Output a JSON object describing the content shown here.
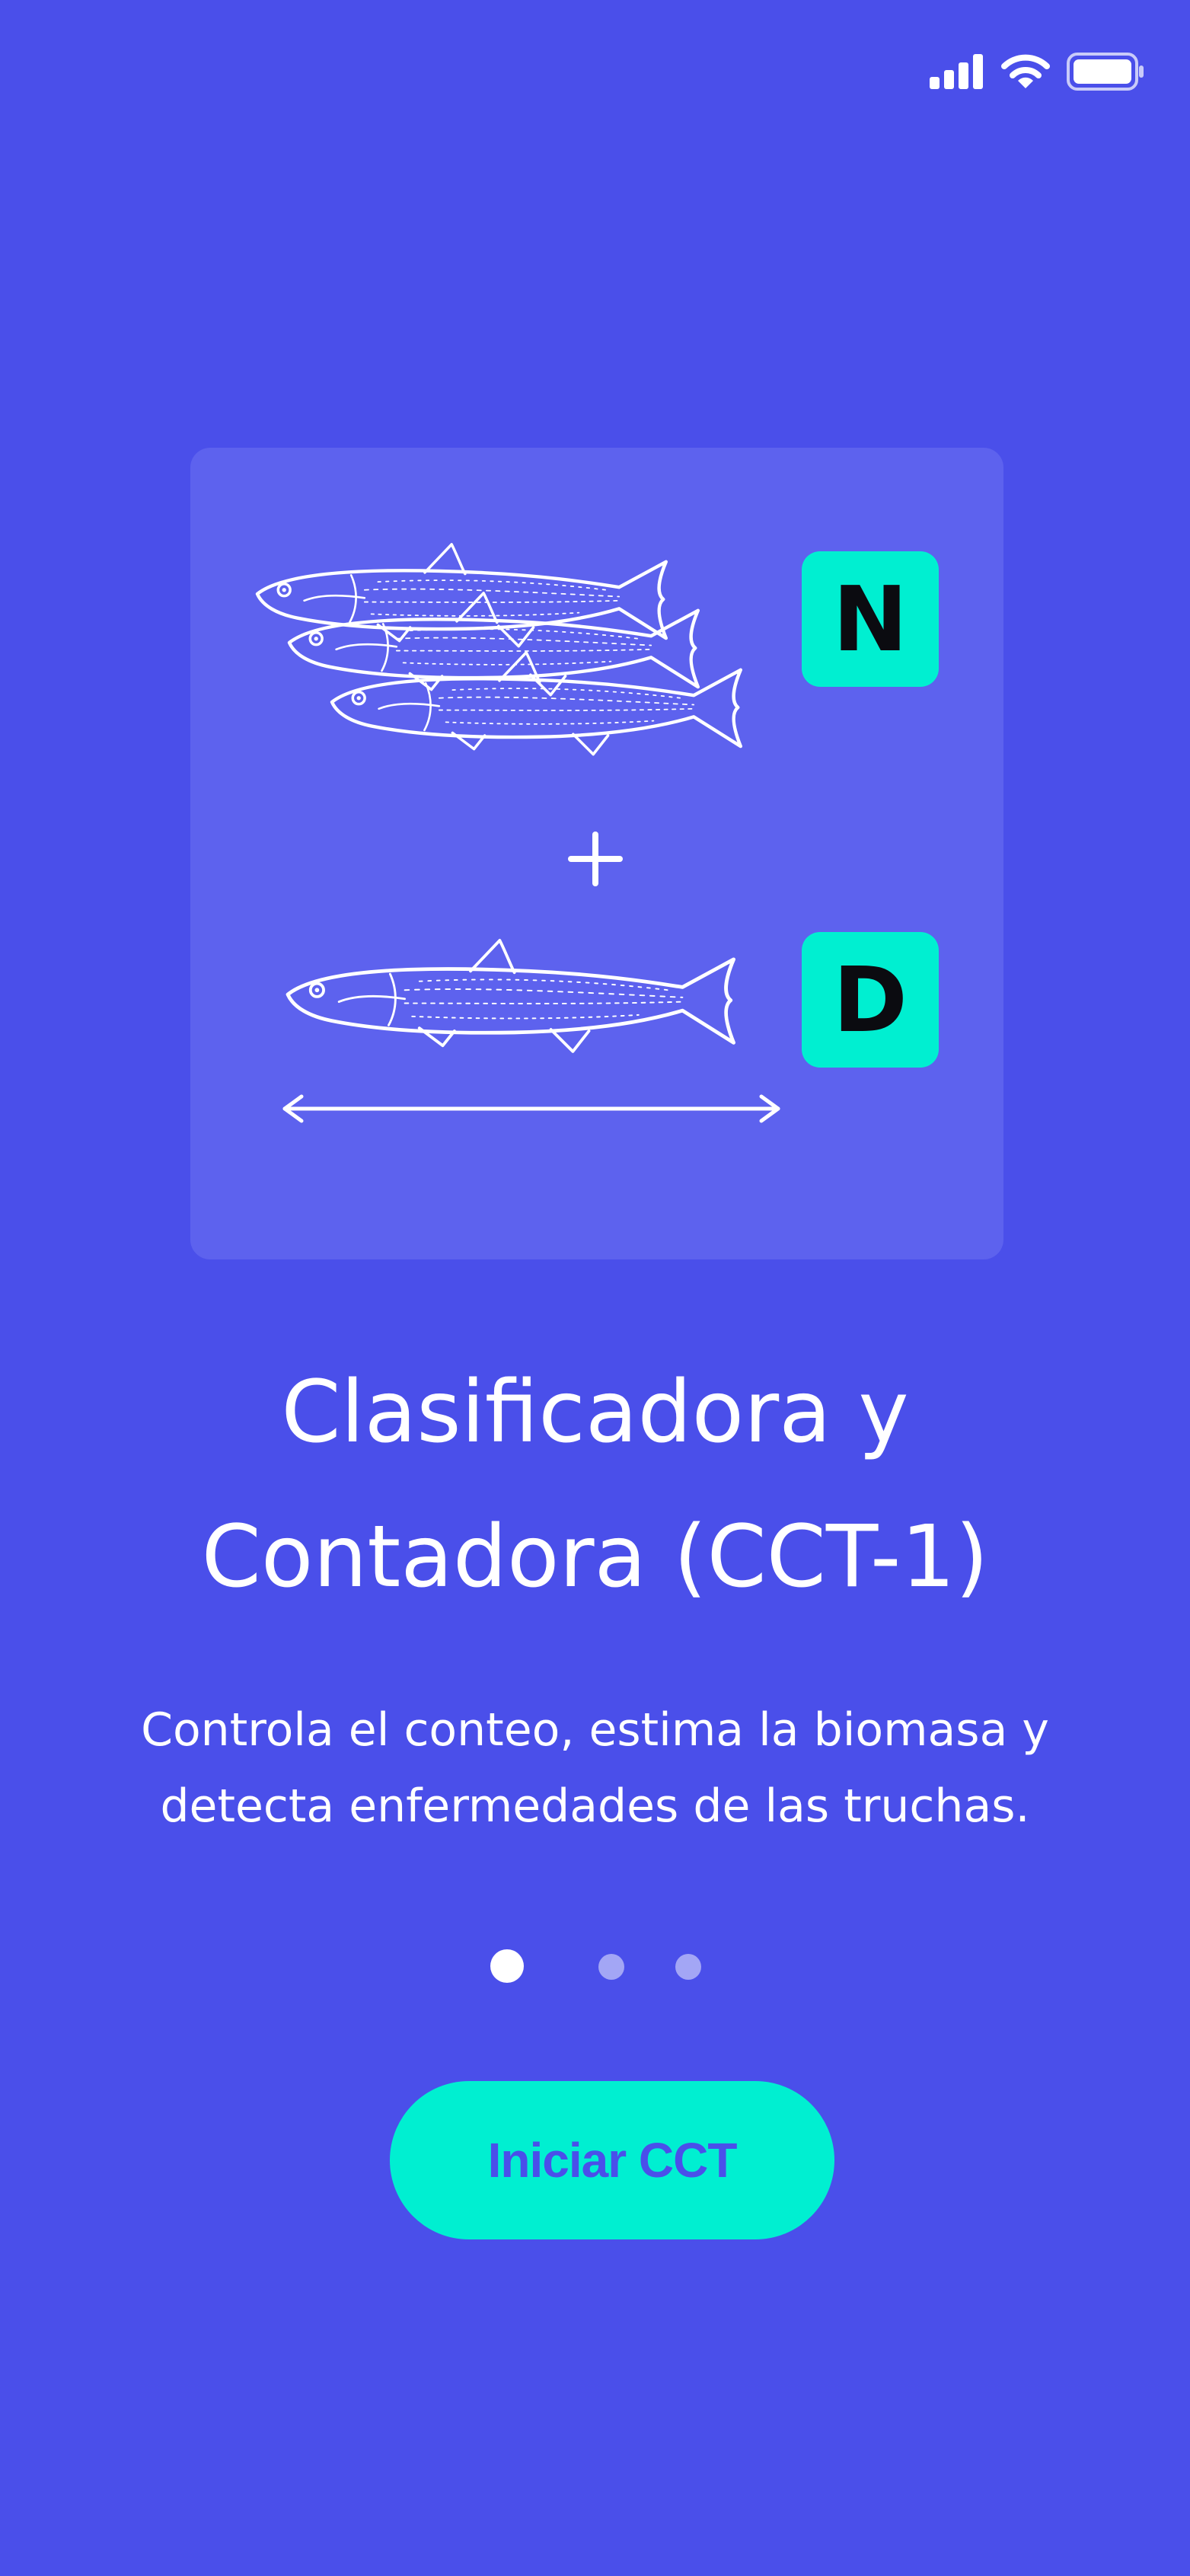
{
  "status_bar": {
    "signal_icon": "cellular-signal-icon",
    "wifi_icon": "wifi-icon",
    "battery_icon": "battery-icon"
  },
  "illustration": {
    "badge_top": "N",
    "badge_bottom": "D",
    "plus_sign": "+",
    "badge_color": "#00efd1"
  },
  "onboarding": {
    "title_line_1": "Clasificadora y",
    "title_line_2": "Contadora (CCT-1)",
    "description_line_1": "Controla el conteo, estima la biomasa y",
    "description_line_2": "detecta enfermedades de las truchas.",
    "page_count": 3,
    "current_page": 1
  },
  "cta": {
    "label": "Iniciar CCT"
  },
  "colors": {
    "background": "#4a4fea",
    "card": "#5d62ee",
    "accent": "#00efd1",
    "text": "#ffffff"
  }
}
